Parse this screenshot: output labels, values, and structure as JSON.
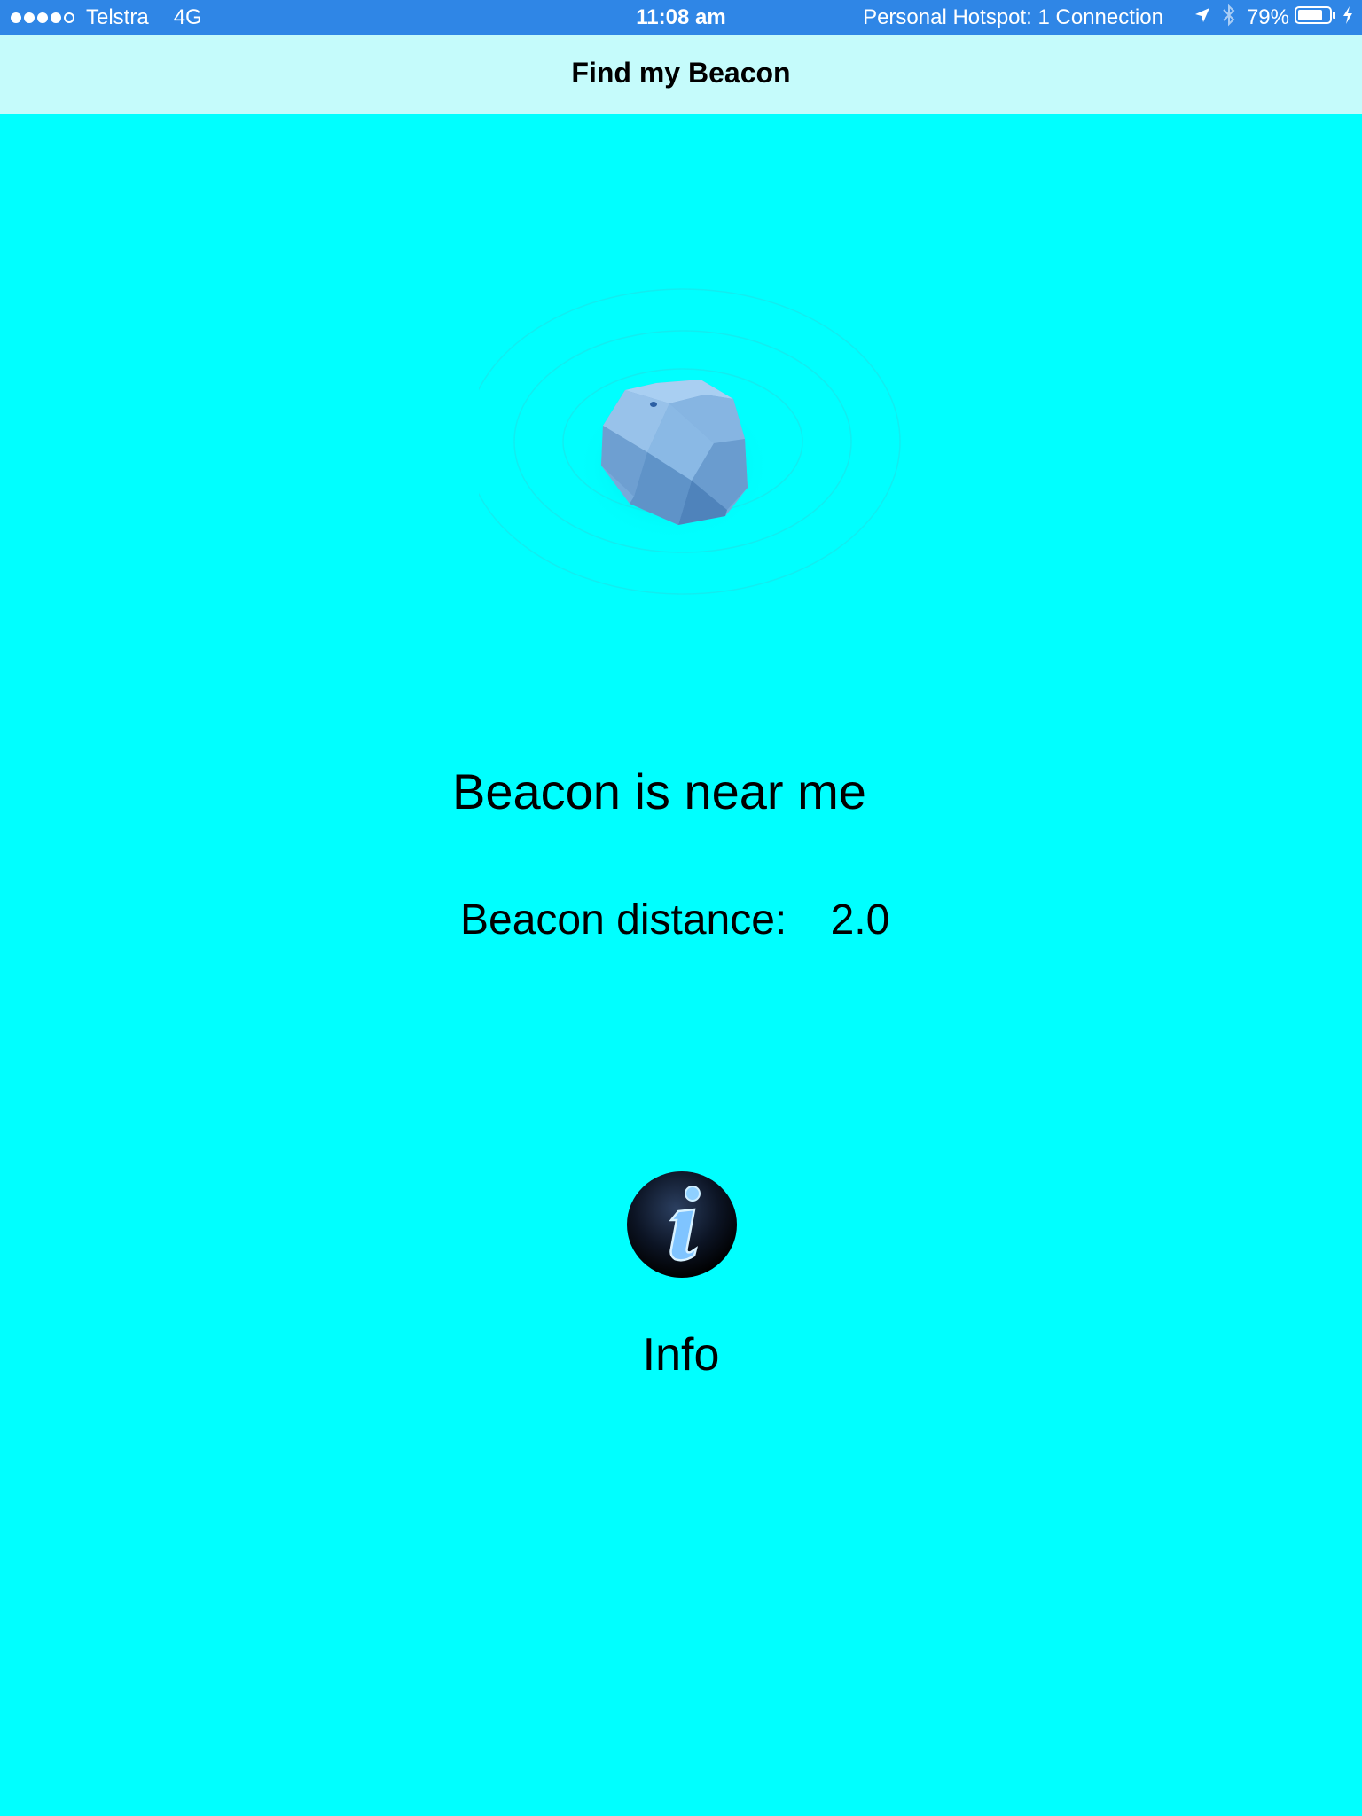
{
  "status_bar": {
    "carrier": "Telstra",
    "network": "4G",
    "time": "11:08 am",
    "hotspot": "Personal Hotspot: 1 Connection",
    "battery_percent": "79%",
    "signal_bars_filled": 4,
    "signal_bars_total": 5,
    "battery_level": 0.79,
    "icons": [
      "location-arrow-icon",
      "bluetooth-icon",
      "battery-icon",
      "charging-bolt-icon"
    ]
  },
  "nav": {
    "title": "Find my Beacon"
  },
  "main": {
    "beacon_image": "beacon-stone-icon",
    "status_message": "Beacon is near me",
    "distance_label": "Beacon distance:",
    "distance_value": "2.0",
    "info_icon": "info-icon",
    "info_label": "Info"
  },
  "colors": {
    "background": "#00ffff",
    "status_bar": "#2f86e6",
    "nav_bar": "#c5fbfb",
    "beacon": "#78a9d9",
    "info_glyph": "#7fc4ff"
  }
}
